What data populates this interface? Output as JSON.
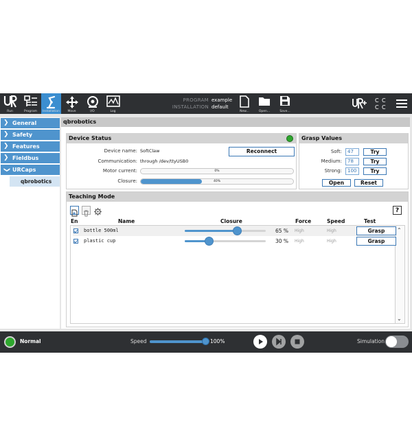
{
  "topbar": {
    "nav": [
      {
        "label": "Run",
        "icon": "ur-logo-icon"
      },
      {
        "label": "Program",
        "icon": "program-icon"
      },
      {
        "label": "Installation",
        "icon": "robot-arm-icon",
        "active": true
      },
      {
        "label": "Move",
        "icon": "move-arrows-icon"
      },
      {
        "label": "I/O",
        "icon": "io-icon"
      },
      {
        "label": "Log",
        "icon": "log-icon"
      }
    ],
    "program_key": "PROGRAM",
    "program_value": "example",
    "installation_key": "INSTALLATION",
    "installation_value": "default",
    "file_buttons": [
      {
        "label": "New...",
        "icon": "new-file-icon"
      },
      {
        "label": "Open...",
        "icon": "open-folder-icon"
      },
      {
        "label": "Save...",
        "icon": "save-icon"
      }
    ],
    "right_icons": [
      "ur-plus-icon",
      "cc-status-icon",
      "menu-icon"
    ]
  },
  "sidebar": {
    "items": [
      {
        "label": "General"
      },
      {
        "label": "Safety"
      },
      {
        "label": "Features"
      },
      {
        "label": "Fieldbus"
      },
      {
        "label": "URCaps"
      }
    ],
    "subitem": "qbrobotics"
  },
  "main": {
    "title": "qbrobotics",
    "device_status": {
      "header": "Device Status",
      "status_color": "#2ea72e",
      "device_name_label": "Device name:",
      "device_name_value": "SoftClaw",
      "communication_label": "Communication:",
      "communication_value": "through /dev/ttyUSB0",
      "motor_current_label": "Motor current:",
      "motor_current_text": "0%",
      "motor_current_fraction": 0.0,
      "closure_label": "Closure:",
      "closure_text": "40%",
      "closure_fraction": 0.4,
      "reconnect_label": "Reconnect"
    },
    "grasp_values": {
      "header": "Grasp Values",
      "rows": [
        {
          "label": "Soft:",
          "value": "47",
          "button": "Try"
        },
        {
          "label": "Medium:",
          "value": "78",
          "button": "Try"
        },
        {
          "label": "Strong:",
          "value": "100",
          "button": "Try"
        }
      ],
      "open_label": "Open",
      "reset_label": "Reset"
    },
    "teaching_mode": {
      "header": "Teaching Mode",
      "help_label": "?",
      "columns": {
        "en": "En",
        "name": "Name",
        "closure": "Closure",
        "force": "Force",
        "speed": "Speed",
        "test": "Test"
      },
      "rows": [
        {
          "name": "bottle 500ml",
          "closure_text": "65 %",
          "closure_fraction": 0.65,
          "force": "High",
          "speed": "High",
          "test": "Grasp"
        },
        {
          "name": "plastic cup",
          "closure_text": "30 %",
          "closure_fraction": 0.3,
          "force": "High",
          "speed": "High",
          "test": "Grasp"
        }
      ]
    }
  },
  "bottombar": {
    "status": "Normal",
    "status_color": "#2ea72e",
    "speed_label": "Speed",
    "speed_value": "100%",
    "speed_fraction": 1.0,
    "simulation_label": "Simulation"
  }
}
